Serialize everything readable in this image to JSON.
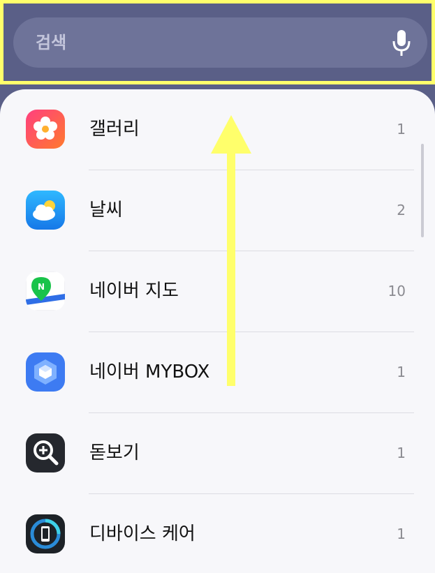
{
  "search": {
    "placeholder": "검색",
    "mic_icon": "microphone-icon"
  },
  "apps": [
    {
      "name": "갤러리",
      "count": "1",
      "icon": "gallery-flower-icon"
    },
    {
      "name": "날씨",
      "count": "2",
      "icon": "weather-icon"
    },
    {
      "name": "네이버 지도",
      "count": "10",
      "icon": "naver-map-icon"
    },
    {
      "name": "네이버 MYBOX",
      "count": "1",
      "icon": "naver-mybox-icon"
    },
    {
      "name": "돋보기",
      "count": "1",
      "icon": "magnifier-icon"
    },
    {
      "name": "디바이스 케어",
      "count": "1",
      "icon": "device-care-icon"
    }
  ],
  "overlay": {
    "highlight_color": "#ffff6b",
    "arrow_direction": "up"
  }
}
